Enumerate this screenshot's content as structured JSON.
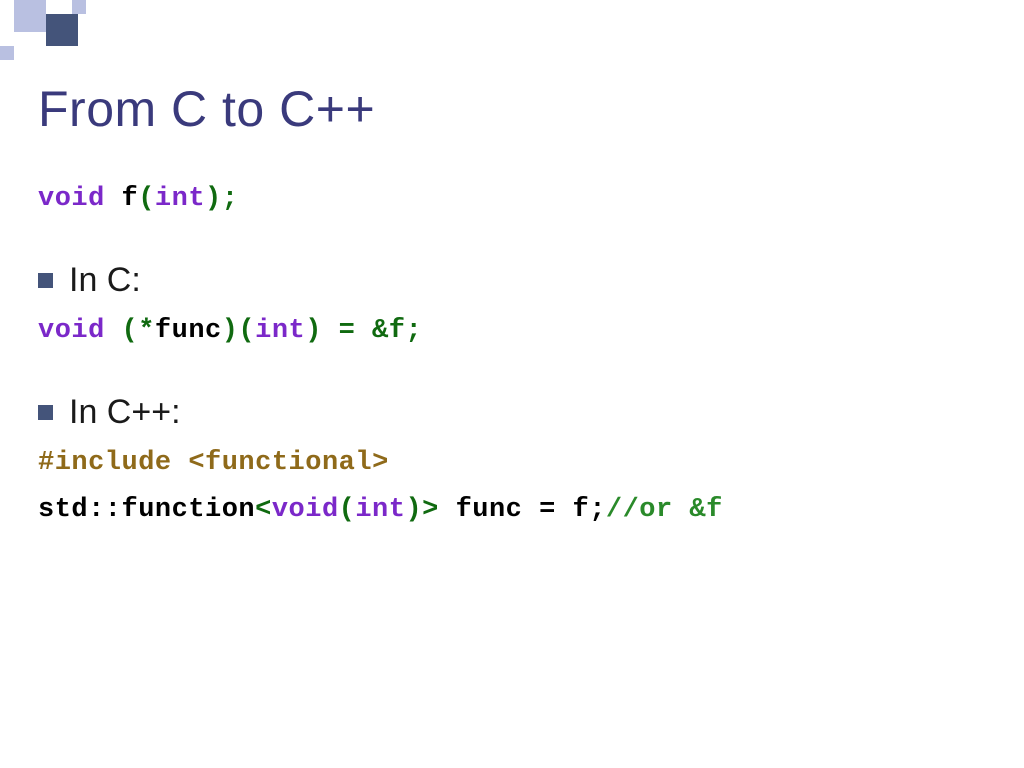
{
  "slide": {
    "title": "From C to C++",
    "decl": {
      "void": "void",
      "f": " f",
      "paren_open": "(",
      "int": "int",
      "paren_close_semi": ");"
    },
    "bullets": {
      "in_c": "In C:",
      "in_cpp": "In C++:"
    },
    "c_line": {
      "void": "void",
      "open": " (*",
      "func": "func",
      "close_open": ")(",
      "int": "int",
      "rest": ") = &f;"
    },
    "include": {
      "hash": "#include",
      "open": " <",
      "header": "functional",
      "close": ">"
    },
    "cpp_line": {
      "std": "std::function",
      "open": "<",
      "void": "void",
      "popen": "(",
      "int": "int",
      "pclose": ")",
      "close": ">",
      "rest": " func = f;",
      "comment": "//or &f"
    }
  }
}
